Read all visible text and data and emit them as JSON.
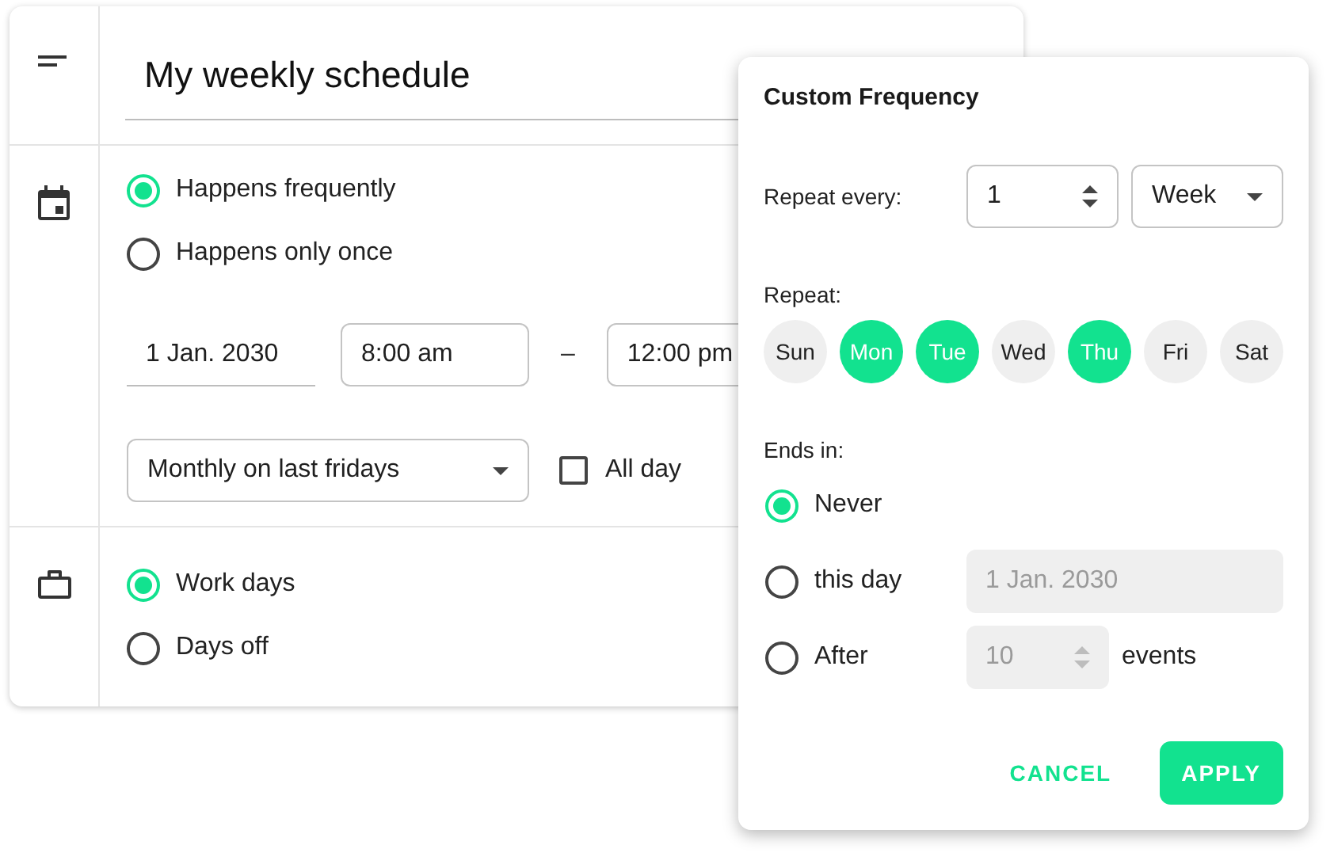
{
  "title_field": {
    "value": "My weekly schedule"
  },
  "frequency_options": [
    {
      "label": "Happens frequently",
      "selected": true
    },
    {
      "label": "Happens only once",
      "selected": false
    }
  ],
  "date_field": {
    "value": "1 Jan. 2030"
  },
  "start_time": {
    "value": "8:00 am"
  },
  "time_separator": "–",
  "end_time": {
    "value": "12:00 pm"
  },
  "recurrence_select": {
    "value": "Monthly on last fridays"
  },
  "all_day": {
    "label": "All day",
    "checked": false
  },
  "day_type_options": [
    {
      "label": "Work days",
      "selected": true
    },
    {
      "label": "Days off",
      "selected": false
    }
  ],
  "dialog": {
    "title": "Custom Frequency",
    "repeat_every": {
      "label": "Repeat every:",
      "count": "1",
      "unit": "Week"
    },
    "repeat": {
      "label": "Repeat:",
      "days": [
        {
          "label": "Sun",
          "selected": false
        },
        {
          "label": "Mon",
          "selected": true
        },
        {
          "label": "Tue",
          "selected": true
        },
        {
          "label": "Wed",
          "selected": false
        },
        {
          "label": "Thu",
          "selected": true
        },
        {
          "label": "Fri",
          "selected": false
        },
        {
          "label": "Sat",
          "selected": false
        }
      ]
    },
    "ends": {
      "label": "Ends in:",
      "options": [
        {
          "kind": "plain",
          "label": "Never",
          "selected": true
        },
        {
          "kind": "date",
          "label": "this day",
          "value": "1 Jan. 2030",
          "selected": false
        },
        {
          "kind": "count",
          "label": "After",
          "value": "10",
          "suffix": "events",
          "selected": false
        }
      ]
    },
    "buttons": [
      {
        "kind": "text",
        "label": "CANCEL"
      },
      {
        "kind": "filled",
        "label": "APPLY"
      }
    ]
  }
}
